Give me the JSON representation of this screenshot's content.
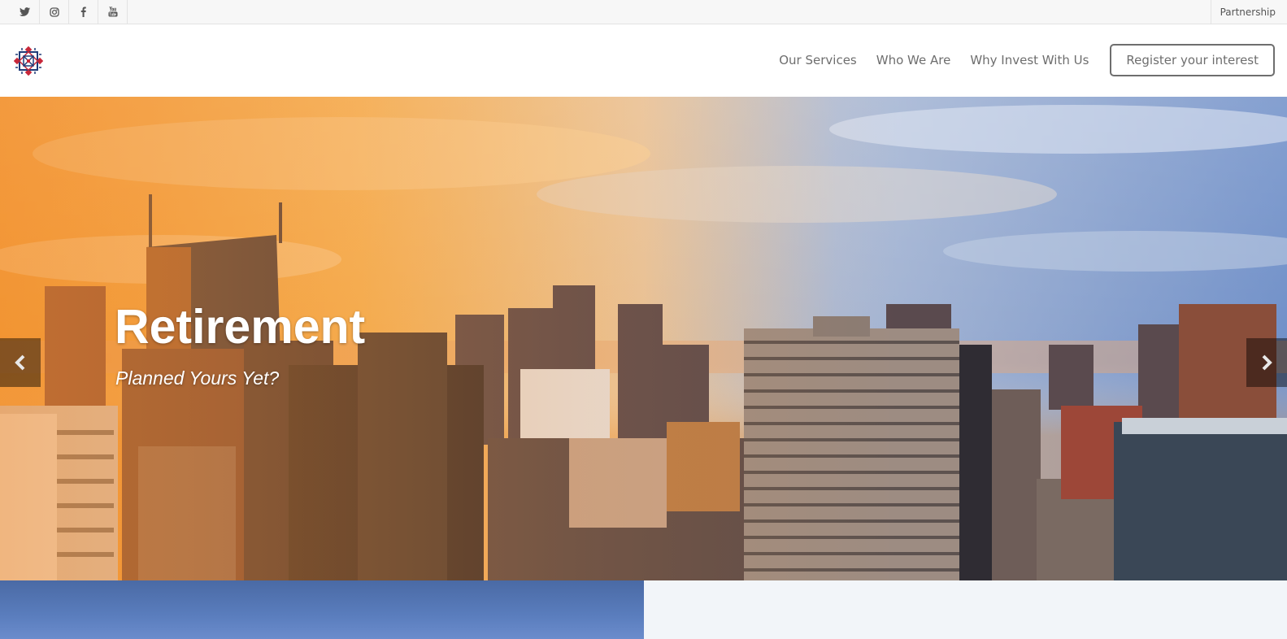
{
  "topbar": {
    "social": [
      {
        "name": "twitter-icon"
      },
      {
        "name": "instagram-icon"
      },
      {
        "name": "facebook-icon"
      },
      {
        "name": "youtube-icon"
      }
    ],
    "right_link": "Partnership"
  },
  "header": {
    "nav": [
      "Our Services",
      "Who We Are",
      "Why Invest With Us"
    ],
    "cta": "Register your interest"
  },
  "hero": {
    "title": "Retirement",
    "subtitle": "Planned Yours Yet?"
  },
  "colors": {
    "nav_text": "#6e6e6e",
    "panel_blue": "#5a7dbd",
    "panel_light": "#f2f5f9"
  }
}
